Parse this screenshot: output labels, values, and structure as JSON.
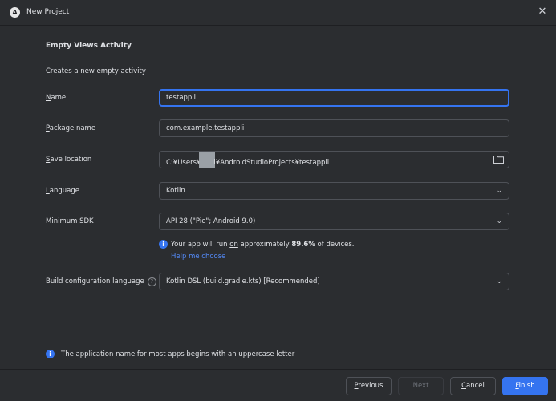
{
  "window": {
    "title": "New Project",
    "logo_letter": "A",
    "close_glyph": "✕"
  },
  "template": {
    "title": "Empty Views Activity",
    "description": "Creates a new empty activity"
  },
  "form": {
    "name": {
      "label_underlined": "N",
      "label_rest": "ame",
      "value": "testappli"
    },
    "package": {
      "label_underlined": "P",
      "label_rest": "ackage name",
      "value": "com.example.testappli"
    },
    "save_location": {
      "label_underlined": "S",
      "label_rest": "ave location",
      "value_before": "C:¥Users¥",
      "value_after": "i¥AndroidStudioProjects¥testappli",
      "icon": "folder-icon"
    },
    "language": {
      "label_underlined": "L",
      "label_rest": "anguage",
      "value": "Kotlin"
    },
    "min_sdk": {
      "label": "Minimum SDK",
      "value": "API 28 (\"Pie\"; Android 9.0)"
    },
    "build_config": {
      "label": "Build configuration language",
      "value": "Kotlin DSL (build.gradle.kts) [Recommended]",
      "help_glyph": "?"
    }
  },
  "sdk_info": {
    "text_before": "Your app will run ",
    "text_on": "on",
    "text_middle": " approximately ",
    "percentage": "89.6%",
    "text_after": " of devices.",
    "help_link": "Help me choose"
  },
  "bottom_note": "The application name for most apps begins with an uppercase letter",
  "buttons": {
    "previous": {
      "u": "P",
      "rest": "revious"
    },
    "next": "Next",
    "cancel": {
      "u": "C",
      "rest": "ancel"
    },
    "finish": {
      "u": "F",
      "rest": "inish"
    }
  },
  "glyphs": {
    "chevron": "⌄",
    "info": "i"
  },
  "colors": {
    "accent": "#3574f0",
    "link": "#548af7",
    "background": "#2b2d30"
  }
}
